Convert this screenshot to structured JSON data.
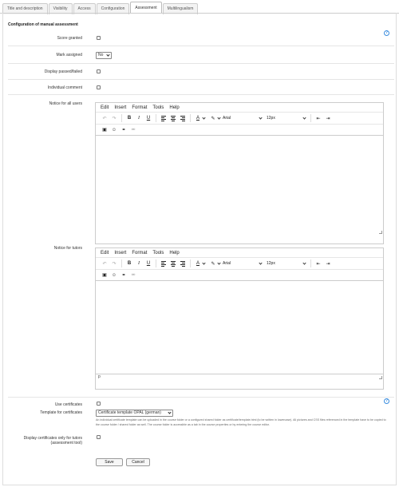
{
  "tabs": [
    {
      "label": "Title and description",
      "active": false
    },
    {
      "label": "Visibility",
      "active": false
    },
    {
      "label": "Access",
      "active": false
    },
    {
      "label": "Configuration",
      "active": false
    },
    {
      "label": "Assessment",
      "active": true
    },
    {
      "label": "Multilingualism",
      "active": false
    }
  ],
  "section": {
    "title": "Configuration of manual assessment"
  },
  "fields": {
    "score_granted": "Score granted",
    "mark_assigned": "Mark assigned",
    "mark_value": "No",
    "display_passed": "Display passed/failed",
    "individual_comment": "Individual comment",
    "notice_all": "Notice for all users",
    "notice_tutors": "Notice for tutors"
  },
  "editor": {
    "menu": [
      "Edit",
      "Insert",
      "Format",
      "Tools",
      "Help"
    ],
    "font": "Arial",
    "size": "12px",
    "path": "p"
  },
  "certificates": {
    "use_label": "Use certificates",
    "template_label": "Template for certificates",
    "template_value": "Certificate template OPAL (german)",
    "description": "An individual certificate template can be uploaded in the course folder or a configured shared folder as certificate/template.html (to be written in lowercase). All pictures and CSS files referenced in the template have to be copied to the course folder / shared folder as well. The course folder is accessible as a tab in the course properties or by entering the course editor.",
    "tutors_label_1": "Display certificates only for tutors",
    "tutors_label_2": "(assessment tool)"
  },
  "buttons": {
    "save": "Save",
    "cancel": "Cancel"
  },
  "icons": {
    "help": "?"
  },
  "colors": {
    "help": "#3a8ddf"
  }
}
